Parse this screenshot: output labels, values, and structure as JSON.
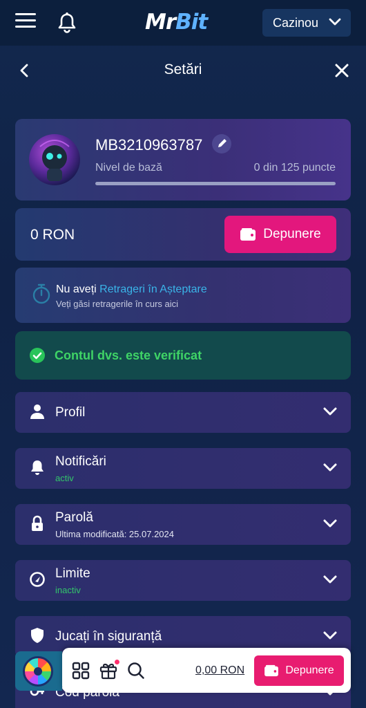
{
  "nav": {
    "logo_part1": "Mr",
    "logo_part2": "Bit",
    "casino_select": "Cazinou"
  },
  "header": {
    "title": "Setări"
  },
  "profile": {
    "username": "MB3210963787",
    "level_label": "Nivel de bază",
    "level_points": "0 din 125 puncte",
    "level_progress_fraction": 0
  },
  "balance": {
    "amount": "0 RON",
    "deposit_label": "Depunere"
  },
  "pending": {
    "prefix": "Nu aveți ",
    "link": "Retrageri în Așteptare",
    "subtitle": "Veți găsi retragerile în curs aici"
  },
  "verified": {
    "text": "Contul dvs. este verificat"
  },
  "sections": [
    {
      "title": "Profil",
      "subtitle": "",
      "icon": "user-icon"
    },
    {
      "title": "Notificări",
      "subtitle": "activ",
      "icon": "bell-icon"
    },
    {
      "title": "Parolă",
      "subtitle": "Ultima modificată: 25.07.2024",
      "icon": "lock-icon"
    },
    {
      "title": "Limite",
      "subtitle": "inactiv",
      "icon": "gauge-icon"
    },
    {
      "title": "Jucați în siguranță",
      "subtitle": "",
      "icon": "shield-icon"
    },
    {
      "title": "Cod parolă",
      "subtitle": "",
      "icon": "key-icon"
    }
  ],
  "bottom_bar": {
    "balance": "0,00 RON",
    "deposit_label": "Depunere"
  },
  "colors": {
    "accent_pink": "#e3177d",
    "link_cyan": "#3ab4e8",
    "success_green": "#3fd466",
    "background": "#102246"
  }
}
